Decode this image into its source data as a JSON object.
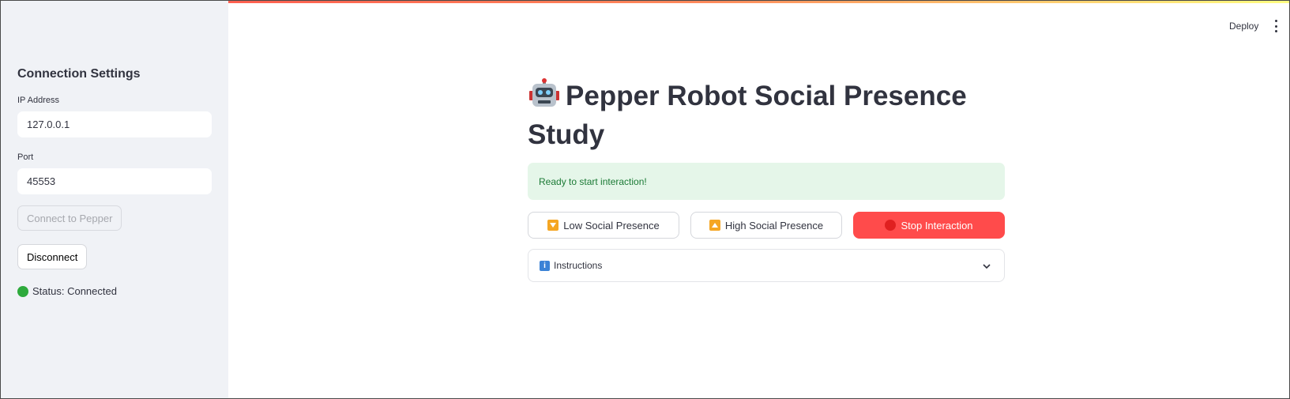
{
  "sidebar": {
    "title": "Connection Settings",
    "ip": {
      "label": "IP Address",
      "value": "127.0.0.1"
    },
    "port": {
      "label": "Port",
      "value": "45553"
    },
    "connect_label": "Connect to Pepper",
    "disconnect_label": "Disconnect",
    "status_text": "Status: Connected",
    "status_color": "#2eaa3c"
  },
  "header": {
    "deploy_label": "Deploy",
    "menu_icon": "kebab-menu-icon"
  },
  "main": {
    "title": "Pepper Robot Social Presence Study",
    "title_icon": "robot-icon",
    "alert_text": "Ready to start interaction!",
    "buttons": [
      {
        "label": "Low Social Presence",
        "icon": "down-triangle-icon"
      },
      {
        "label": "High Social Presence",
        "icon": "up-triangle-icon"
      },
      {
        "label": "Stop Interaction",
        "icon": "stop-icon"
      }
    ],
    "expander_label": "Instructions",
    "expander_icon": "info-icon"
  },
  "colors": {
    "accent": "#ff4b4b",
    "sidebar_bg": "#f0f2f6",
    "success_bg": "#e5f6e9",
    "success_text": "#1b7a35"
  }
}
